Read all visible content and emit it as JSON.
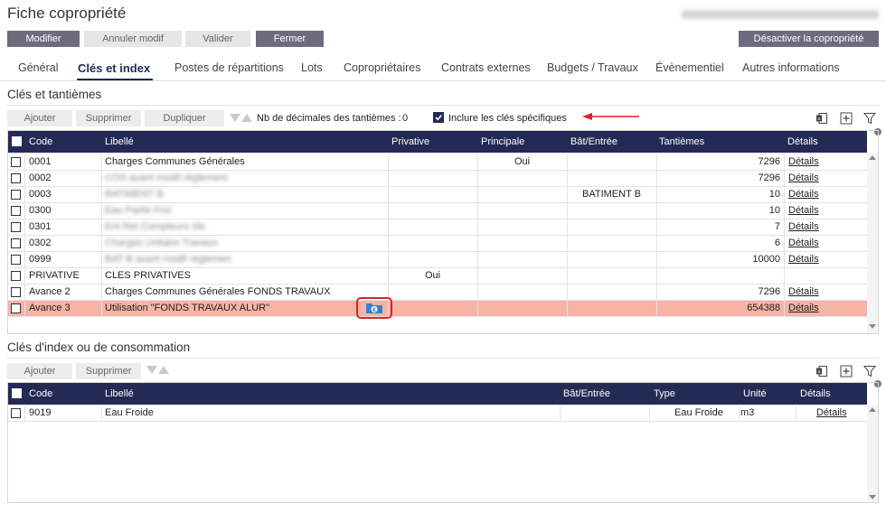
{
  "app": {
    "title": "Fiche copropriété",
    "blurred_header_text": "MODIFIÉ LE 11/10/2022 par Coproprio"
  },
  "toolbar": {
    "modifier": "Modifier",
    "annuler": "Annuler modif",
    "valider": "Valider",
    "fermer": "Fermer",
    "desactiver": "Désactiver la copropriété"
  },
  "tabs": [
    {
      "label": "Général"
    },
    {
      "label": "Clés et index"
    },
    {
      "label": "Postes de répartitions"
    },
    {
      "label": "Lots"
    },
    {
      "label": "Copropriétaires"
    },
    {
      "label": "Contrats externes"
    },
    {
      "label": "Budgets / Travaux"
    },
    {
      "label": "Évènementiel"
    },
    {
      "label": "Autres informations"
    }
  ],
  "keys_section": {
    "title": "Clés et tantièmes",
    "ajouter": "Ajouter",
    "supprimer": "Supprimer",
    "dupliquer": "Dupliquer",
    "decimals_label": "Nb de décimales des tantièmes :",
    "decimals_value": "0",
    "include_label": "Inclure les clés spécifiques",
    "columns": [
      "Code",
      "Libellé",
      "Privative",
      "Principale",
      "Bât/Entrée",
      "Tantièmes",
      "Détails"
    ],
    "rows": [
      {
        "code": "0001",
        "libelle": "Charges Communes Générales",
        "privative": "",
        "principale": "Oui",
        "bat": "",
        "tantiemes": "7296",
        "details": "Détails"
      },
      {
        "code": "0002",
        "libelle": "COS avant modif règlement",
        "privative": "",
        "principale": "",
        "bat": "",
        "tantiemes": "7296",
        "details": "Détails"
      },
      {
        "code": "0003",
        "libelle": "BATIMENT B",
        "privative": "",
        "principale": "",
        "bat": "BATIMENT B",
        "tantiemes": "10",
        "details": "Détails"
      },
      {
        "code": "0300",
        "libelle": "Eau Partie Froi",
        "privative": "",
        "principale": "",
        "bat": "",
        "tantiemes": "10",
        "details": "Détails"
      },
      {
        "code": "0301",
        "libelle": "Ent Ret Compteurs Idx",
        "privative": "",
        "principale": "",
        "bat": "",
        "tantiemes": "7",
        "details": "Détails"
      },
      {
        "code": "0302",
        "libelle": "Charges Unitaire Travaux",
        "privative": "",
        "principale": "",
        "bat": "",
        "tantiemes": "6",
        "details": "Détails"
      },
      {
        "code": "0999",
        "libelle": "BAT B avant modif règlement",
        "privative": "",
        "principale": "",
        "bat": "",
        "tantiemes": "10000",
        "details": "Détails"
      },
      {
        "code": "PRIVATIVE",
        "libelle": "CLES PRIVATIVES",
        "privative": "Oui",
        "principale": "",
        "bat": "",
        "tantiemes": "",
        "details": ""
      },
      {
        "code": "Avance 2",
        "libelle": "Charges Communes Générales FONDS TRAVAUX",
        "privative": "",
        "principale": "",
        "bat": "",
        "tantiemes": "7296",
        "details": "Détails"
      },
      {
        "code": "Avance 3",
        "libelle": "Utilisation \"FONDS TRAVAUX ALUR\"",
        "privative": "",
        "principale": "",
        "bat": "",
        "tantiemes": "654388",
        "details": "Détails"
      }
    ]
  },
  "index_section": {
    "title": "Clés d'index ou de consommation",
    "ajouter": "Ajouter",
    "supprimer": "Supprimer",
    "columns": [
      "Code",
      "Libellé",
      "Bât/Entrée",
      "Type",
      "Unité",
      "Détails"
    ],
    "rows": [
      {
        "code": "9019",
        "libelle": "Eau Froide",
        "bat": "",
        "type": "Eau Froide",
        "unite": "m3",
        "details": "Détails"
      }
    ]
  },
  "colors": {
    "header_navy": "#232b55",
    "button_dark": "#6b6c7e",
    "highlight_row": "#f6b4a5",
    "annotation_red": "#d9232b",
    "euro_icon": "#3c7fc6"
  }
}
